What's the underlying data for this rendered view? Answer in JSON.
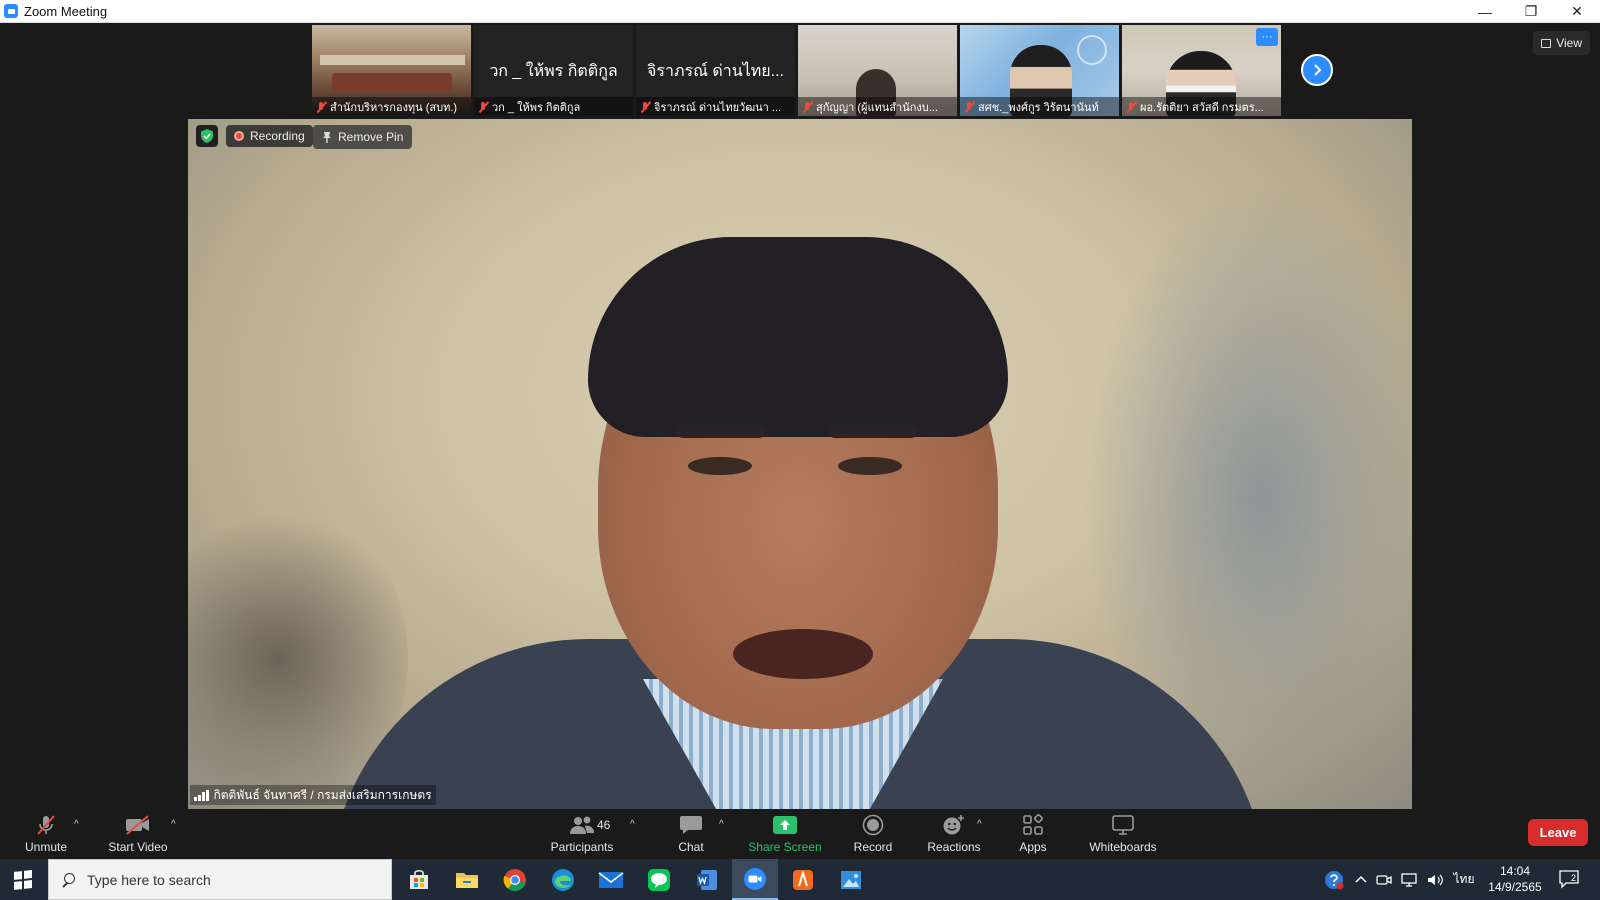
{
  "window": {
    "title": "Zoom Meeting",
    "minimize": "—",
    "restore": "❐",
    "close": "✕"
  },
  "thumbnails": [
    {
      "label": "สำนักบริหารกองทุน (สบท.)",
      "mic_muted": true,
      "show_name_only": false
    },
    {
      "label": "วก _ ให้พร กิตติกูล",
      "display_name": "วก _ ให้พร กิตติกูล",
      "mic_muted": true,
      "show_name_only": true
    },
    {
      "label": "จิราภรณ์ ด่านไทยวัฒนา ...",
      "display_name": "จิราภรณ์ ด่านไทย...",
      "mic_muted": true,
      "show_name_only": true
    },
    {
      "label": "สุกัญญา (ผู้แทนสำนักงบ...",
      "mic_muted": true,
      "show_name_only": false
    },
    {
      "label": "สศช._พงศ์กูร วิรัตนานันท์",
      "mic_muted": true,
      "show_name_only": false
    },
    {
      "label": "ผอ.รัตติยา สวัสดี กรมตร...",
      "mic_muted": true,
      "show_name_only": false,
      "more_label": "···"
    }
  ],
  "view_button": "View",
  "main": {
    "recording_label": "Recording",
    "remove_pin_label": "Remove Pin",
    "speaker_name": "กิตติพันธ์ จันทาศรี / กรมส่งเสริมการเกษตร"
  },
  "toolbar": {
    "unmute": "Unmute",
    "start_video": "Start Video",
    "participants": "Participants",
    "participants_count": "46",
    "chat": "Chat",
    "share_screen": "Share Screen",
    "record": "Record",
    "reactions": "Reactions",
    "apps": "Apps",
    "whiteboards": "Whiteboards",
    "leave": "Leave"
  },
  "taskbar": {
    "search_placeholder": "Type here to search",
    "apps": [
      "store",
      "file-explorer",
      "chrome",
      "edge",
      "mail",
      "line",
      "word",
      "zoom",
      "pdf-reader",
      "photos"
    ],
    "tray_language": "ไทย",
    "time": "14:04",
    "date": "14/9/2565",
    "notification_count": "2"
  },
  "colors": {
    "zoom_blue": "#2d8cff",
    "share_green": "#29c26a",
    "leave_red": "#d82c2c",
    "muted_red": "#e74c3c"
  }
}
